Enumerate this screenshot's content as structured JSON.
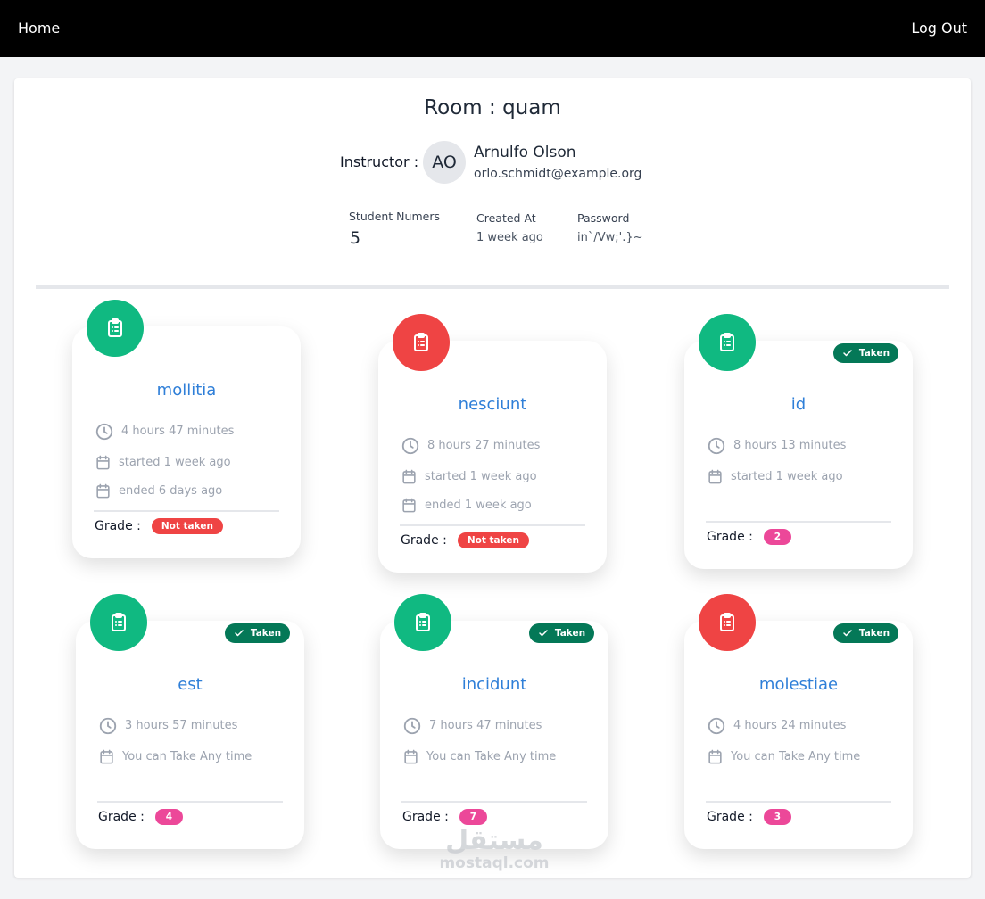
{
  "nav": {
    "home": "Home",
    "logout": "Log Out"
  },
  "room": {
    "title": "Room : quam",
    "instructor_label": "Instructor :",
    "avatar_initials": "AO",
    "instructor_name": "Arnulfo Olson",
    "instructor_email": "orlo.schmidt@example.org",
    "stats": {
      "students_label": "Student Numers",
      "students_value": "5",
      "created_label": "Created At",
      "created_value": "1 week ago",
      "password_label": "Password",
      "password_value": "in`/Vw;'.}~"
    }
  },
  "labels": {
    "grade": "Grade :",
    "taken": "Taken"
  },
  "colors": {
    "green": "#10b981",
    "red": "#ef4444",
    "taken": "#047857",
    "pink": "#ec4899",
    "title_blue": "#2f7fd8"
  },
  "exams": [
    {
      "title": "mollitia",
      "duration": "4 hours 47 minutes",
      "started": "started 1 week ago",
      "ended": "ended 6 days ago",
      "grade": "Not taken",
      "icon_color": "green",
      "taken": false
    },
    {
      "title": "nesciunt",
      "duration": "8 hours 27 minutes",
      "started": "started 1 week ago",
      "ended": "ended 1 week ago",
      "grade": "Not taken",
      "icon_color": "red",
      "taken": false
    },
    {
      "title": "id",
      "duration": "8 hours 13 minutes",
      "started": "started 1 week ago",
      "grade": "2",
      "icon_color": "green",
      "taken": true
    },
    {
      "title": "est",
      "duration": "3 hours 57 minutes",
      "availability": "You can Take Any time",
      "grade": "4",
      "icon_color": "green",
      "taken": true
    },
    {
      "title": "incidunt",
      "duration": "7 hours 47 minutes",
      "availability": "You can Take Any time",
      "grade": "7",
      "icon_color": "green",
      "taken": true
    },
    {
      "title": "molestiae",
      "duration": "4 hours 24 minutes",
      "availability": "You can Take Any time",
      "grade": "3",
      "icon_color": "red",
      "taken": true
    }
  ],
  "watermark": {
    "arabic": "مستقل",
    "latin": "mostaql.com"
  }
}
